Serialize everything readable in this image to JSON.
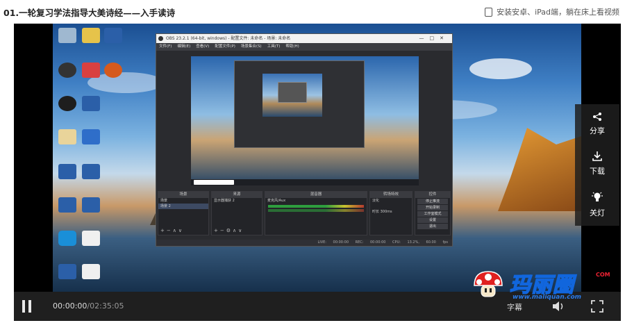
{
  "header": {
    "lesson_title": "01.一轮复习学法指导大美诗经——入手读诗",
    "promo_text": "安装安卓、iPad端，躺在床上看视频"
  },
  "video": {
    "obs_window_title": "OBS 23.2.1 (64-bit, windows) - 配置文件: 未命名 - 场景: 未命名",
    "obs_menu": [
      "文件(F)",
      "编辑(E)",
      "查看(V)",
      "配置文件(P)",
      "场景集合(S)",
      "工具(T)",
      "帮助(H)"
    ],
    "docks": {
      "scenes": {
        "label": "场景",
        "items": [
          "场景",
          "场景 2"
        ]
      },
      "sources": {
        "label": "来源",
        "items": [
          "显示器捕获 2"
        ]
      },
      "mixer": {
        "label": "混音器",
        "items": [
          "麦克风/Aux"
        ]
      },
      "transitions": {
        "label": "转场特效",
        "items": [
          "淡化",
          "时长",
          "300ms"
        ]
      },
      "controls": {
        "label": "控件",
        "items": [
          "停止推流",
          "开始录制",
          "工作室模式",
          "设置",
          "退出"
        ]
      }
    },
    "status_bar": "LIVE: 00:00:00 REC: 00:00:00 CPU: 13.2%, 60.00 fps"
  },
  "side_panel": {
    "share_label": "分享",
    "download_label": "下载",
    "lights_off_label": "关灯"
  },
  "controls": {
    "current_time": "00:00:00",
    "total_time": "/02:35:05",
    "subtitle_label": "字幕"
  },
  "watermark": {
    "brand": "玛丽圈",
    "url": "www.maliquan.com",
    "suffix": "COM"
  },
  "colors": {
    "accent": "#1166dd",
    "panel_bg": "#1f1f1f"
  }
}
